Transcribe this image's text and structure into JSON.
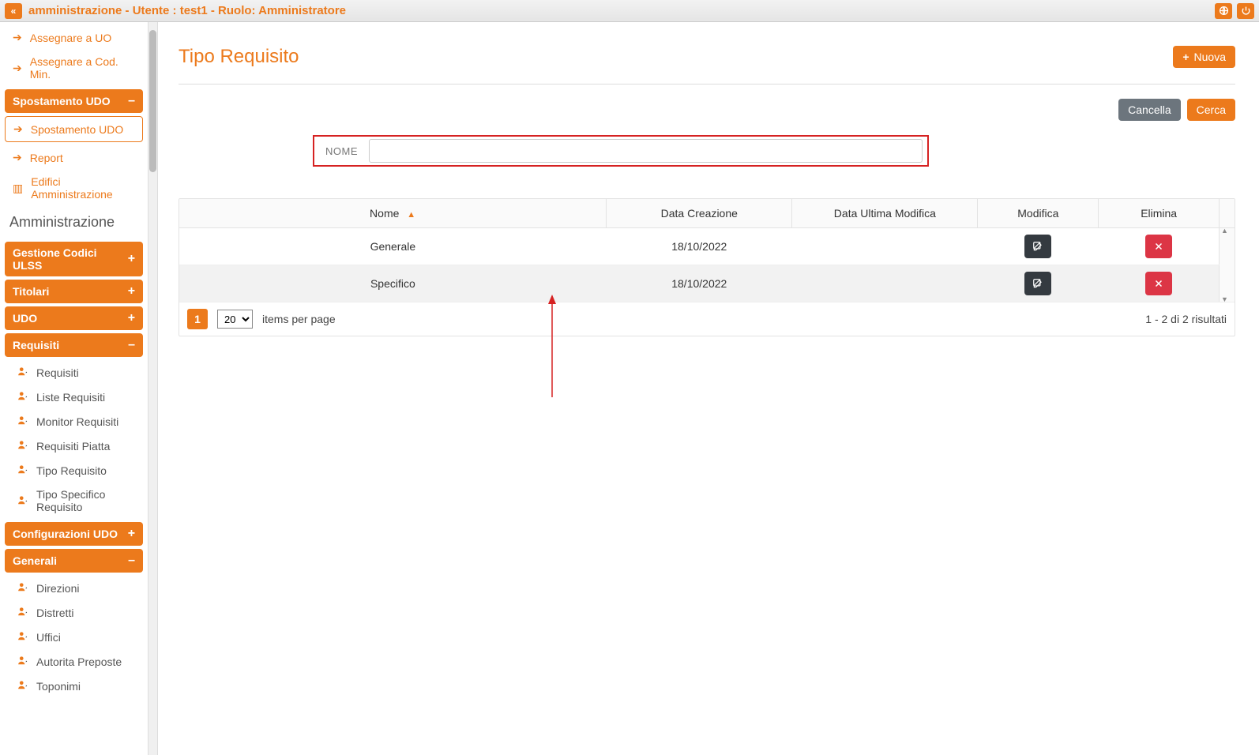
{
  "topbar": {
    "title": "amministrazione - Utente : test1 - Ruolo: Amministratore"
  },
  "sidebar": {
    "top_items": [
      {
        "label": "Assegnare a UO"
      },
      {
        "label": "Assegnare a Cod. Min."
      }
    ],
    "spostamento": {
      "header": "Spostamento UDO",
      "item": "Spostamento UDO"
    },
    "simple_items": [
      {
        "label": "Report"
      },
      {
        "label": "Edifici Amministrazione"
      }
    ],
    "section_title": "Amministrazione",
    "groups": {
      "gestione": {
        "label": "Gestione Codici ULSS",
        "toggle": "+"
      },
      "titolari": {
        "label": "Titolari",
        "toggle": "+"
      },
      "udo": {
        "label": "UDO",
        "toggle": "+"
      },
      "requisiti": {
        "label": "Requisiti",
        "toggle": "–",
        "items": [
          "Requisiti",
          "Liste Requisiti",
          "Monitor Requisiti",
          "Requisiti Piatta",
          "Tipo Requisito",
          "Tipo Specifico Requisito"
        ]
      },
      "configurazioni": {
        "label": "Configurazioni UDO",
        "toggle": "+"
      },
      "generali": {
        "label": "Generali",
        "toggle": "–",
        "items": [
          "Direzioni",
          "Distretti",
          "Uffici",
          "Autorita Preposte",
          "Toponimi"
        ]
      }
    }
  },
  "page": {
    "title": "Tipo Requisito",
    "new_btn": "Nuova",
    "cancel_btn": "Cancella",
    "search_btn": "Cerca",
    "search_label": "NOME"
  },
  "table": {
    "cols": {
      "nome": "Nome",
      "data_creazione": "Data Creazione",
      "data_modifica": "Data Ultima Modifica",
      "modifica": "Modifica",
      "elimina": "Elimina"
    },
    "rows": [
      {
        "nome": "Generale",
        "data_creazione": "18/10/2022",
        "data_modifica": ""
      },
      {
        "nome": "Specifico",
        "data_creazione": "18/10/2022",
        "data_modifica": ""
      }
    ],
    "footer": {
      "page": "1",
      "per_page_value": "20",
      "per_page_label": "items per page",
      "results": "1 - 2 di 2 risultati"
    }
  }
}
